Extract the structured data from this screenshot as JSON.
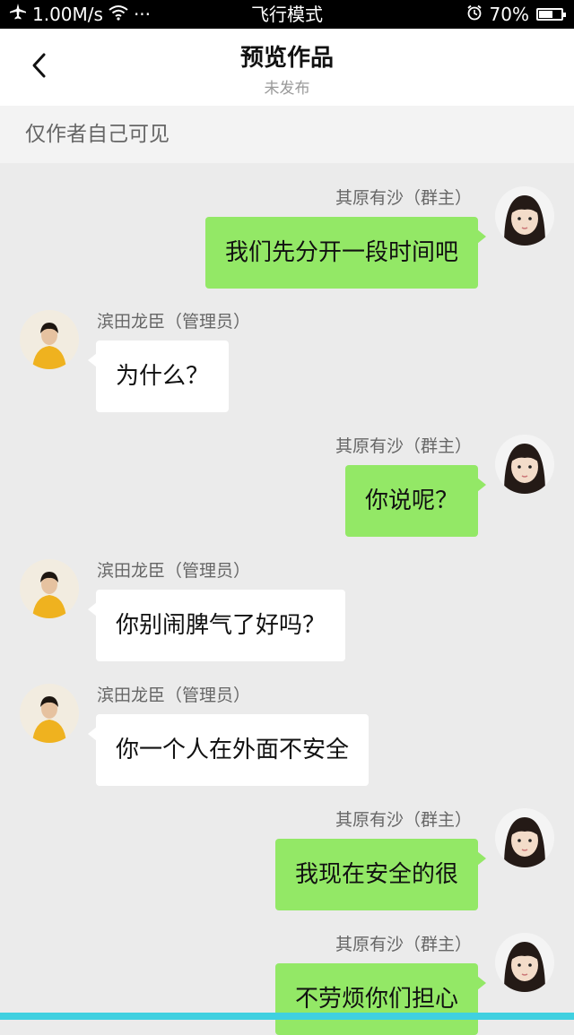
{
  "status_bar": {
    "speed": "1.00M/s",
    "dots": "···",
    "mode": "飞行模式",
    "battery_text": "70%",
    "battery_level": 0.7
  },
  "header": {
    "title": "预览作品",
    "subtitle": "未发布"
  },
  "notice": "仅作者自己可见",
  "messages": [
    {
      "side": "right",
      "name": "其原有沙（群主）",
      "text": "我们先分开一段时间吧"
    },
    {
      "side": "left",
      "name": "滨田龙臣（管理员）",
      "text": "为什么？"
    },
    {
      "side": "right",
      "name": "其原有沙（群主）",
      "text": "你说呢？"
    },
    {
      "side": "left",
      "name": "滨田龙臣（管理员）",
      "text": "你别闹脾气了好吗？"
    },
    {
      "side": "left",
      "name": "滨田龙臣（管理员）",
      "text": "你一个人在外面不安全"
    },
    {
      "side": "right",
      "name": "其原有沙（群主）",
      "text": "我现在安全的很"
    },
    {
      "side": "right",
      "name": "其原有沙（群主）",
      "text": "不劳烦你们担心"
    }
  ],
  "colors": {
    "bubble_sent": "#93e866",
    "bubble_received": "#ffffff",
    "background": "#ebebeb"
  }
}
